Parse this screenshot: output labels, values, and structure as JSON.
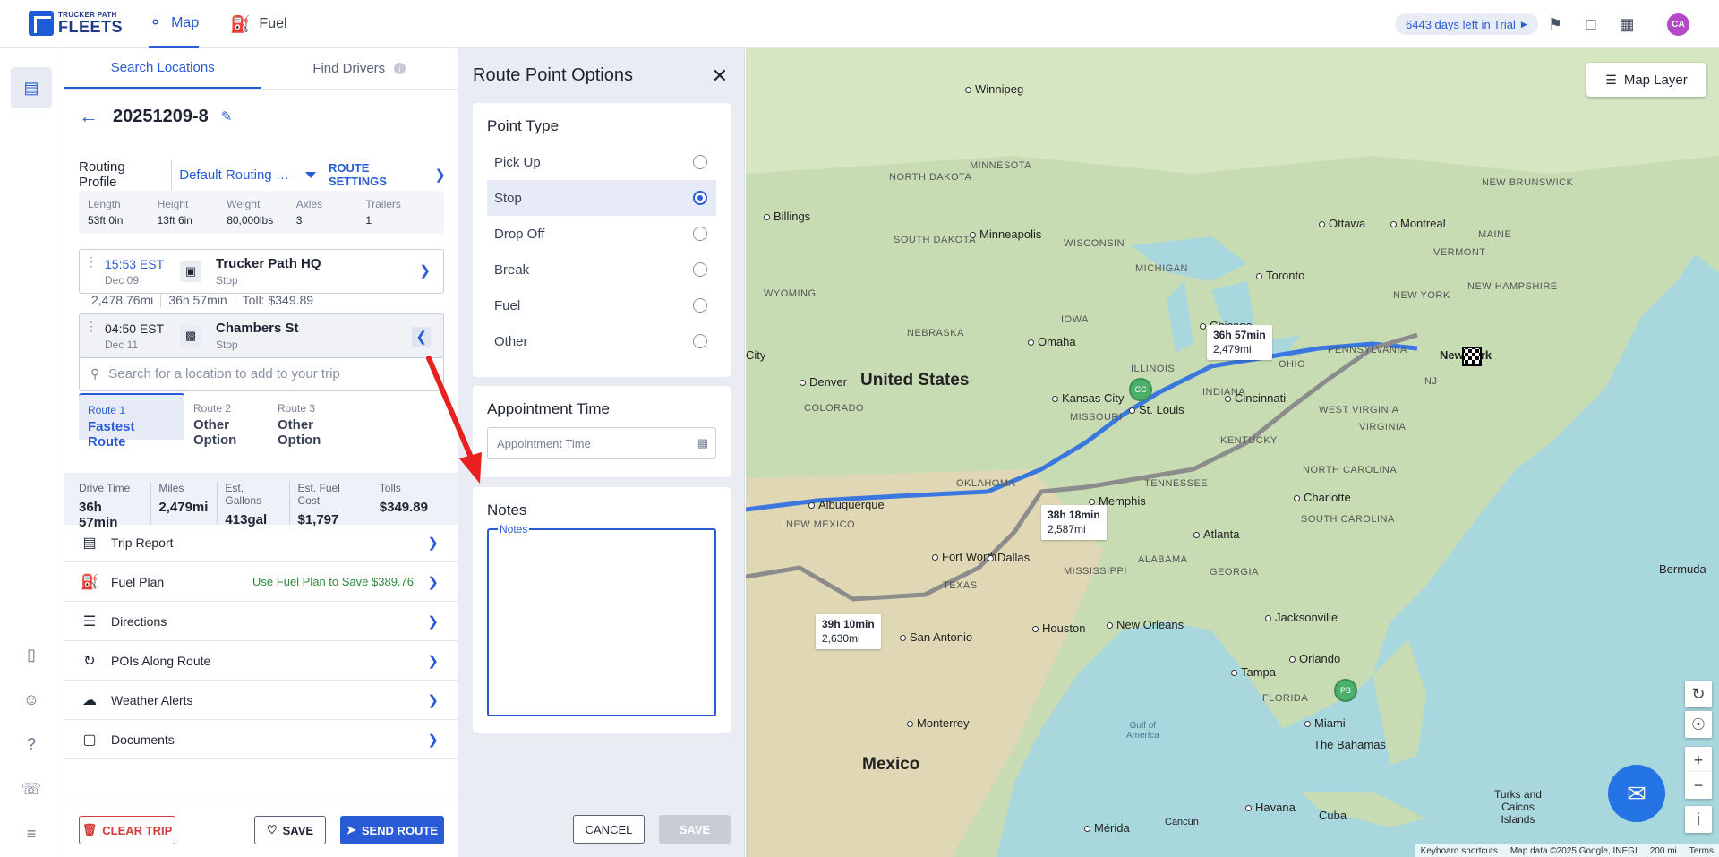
{
  "brand": {
    "small": "TRUCKER PATH",
    "big": "FLEETS"
  },
  "nav": {
    "map": "Map",
    "fuel": "Fuel"
  },
  "trial": "6443 days left in Trial",
  "user_initials": "CA",
  "search_tabs": {
    "search": "Search Locations",
    "drivers": "Find Drivers",
    "info": "i"
  },
  "trip": {
    "name": "20251209-8"
  },
  "routing": {
    "label": "Routing Profile",
    "value": "Default Routing Pr...",
    "settings": "ROUTE SETTINGS"
  },
  "specs": [
    {
      "label": "Length",
      "value": "53ft 0in"
    },
    {
      "label": "Height",
      "value": "13ft 6in"
    },
    {
      "label": "Weight",
      "value": "80,000lbs"
    },
    {
      "label": "Axles",
      "value": "3"
    },
    {
      "label": "Trailers",
      "value": "1"
    }
  ],
  "stops": [
    {
      "time": "15:53 EST",
      "date": "Dec 09",
      "name": "Trucker Path HQ",
      "kind": "Stop"
    },
    {
      "time": "04:50 EST",
      "date": "Dec 11",
      "name": "Chambers St",
      "kind": "Stop"
    }
  ],
  "between": {
    "miles": "2,478.76mi",
    "time": "36h 57min",
    "toll": "Toll: $349.89"
  },
  "search_placeholder": "Search for a location to add to your trip",
  "routes": [
    {
      "num": "Route 1",
      "name": "Fastest Route"
    },
    {
      "num": "Route 2",
      "name": "Other Option"
    },
    {
      "num": "Route 3",
      "name": "Other Option"
    }
  ],
  "metrics": [
    {
      "label": "Drive Time",
      "value": "36h 57min"
    },
    {
      "label": "Miles",
      "value": "2,479mi"
    },
    {
      "label": "Est. Gallons",
      "value": "413gal"
    },
    {
      "label": "Est. Fuel Cost",
      "value": "$1,797"
    },
    {
      "label": "Tolls",
      "value": "$349.89"
    }
  ],
  "menu": [
    {
      "label": "Trip Report",
      "icon": "document-icon"
    },
    {
      "label": "Fuel Plan",
      "icon": "fuel-pump-icon",
      "promo": "Use Fuel Plan to Save $389.76"
    },
    {
      "label": "Directions",
      "icon": "list-icon"
    },
    {
      "label": "POIs Along Route",
      "icon": "route-icon"
    },
    {
      "label": "Weather Alerts",
      "icon": "cloud-icon"
    },
    {
      "label": "Documents",
      "icon": "folder-icon"
    }
  ],
  "footer": {
    "clear": "CLEAR TRIP",
    "save": "SAVE",
    "send": "SEND ROUTE"
  },
  "rpo": {
    "title": "Route Point Options",
    "point_type": "Point Type",
    "options": [
      "Pick Up",
      "Stop",
      "Drop Off",
      "Break",
      "Fuel",
      "Other"
    ],
    "selected": "Stop",
    "appt_title": "Appointment Time",
    "appt_placeholder": "Appointment Time",
    "notes_title": "Notes",
    "notes_legend": "Notes",
    "cancel": "CANCEL",
    "save": "SAVE"
  },
  "map": {
    "layer_btn": "Map Layer",
    "route_labels": [
      {
        "time": "36h 57min",
        "dist": "2,479mi"
      },
      {
        "time": "38h 18min",
        "dist": "2,587mi"
      },
      {
        "time": "39h 10min",
        "dist": "2,630mi"
      }
    ],
    "pins": [
      "CC",
      "PB"
    ],
    "labels": {
      "country_us": "United States",
      "country_mx": "Mexico",
      "winnipeg": "Winnipeg",
      "north_dakota": "NORTH DAKOTA",
      "south_dakota": "SOUTH DAKOTA",
      "minnesota": "MINNESOTA",
      "minneapolis": "Minneapolis",
      "wisconsin": "WISCONSIN",
      "michigan": "MICHIGAN",
      "iowa": "IOWA",
      "nebraska": "NEBRASKA",
      "omaha": "Omaha",
      "illinois": "ILLINOIS",
      "chicago": "Chicago",
      "ohio": "OHIO",
      "indiana": "INDIANA",
      "denver": "Denver",
      "colorado": "COLORADO",
      "kansas_city": "Kansas City",
      "missouri": "MISSOURI",
      "st_louis": "St. Louis",
      "cincinnati": "Cincinnati",
      "kentucky": "KENTUCKY",
      "west_virginia": "WEST VIRGINIA",
      "virginia": "VIRGINIA",
      "pennsylvania": "PENNSYLVANIA",
      "new_york_state": "NEW YORK",
      "new_york": "New York",
      "nj": "NJ",
      "toronto": "Toronto",
      "ottawa": "Ottawa",
      "montreal": "Montreal",
      "maine": "MAINE",
      "new_brunswick": "NEW BRUNSWICK",
      "new_hampshire": "NEW HAMPSHIRE",
      "vermont": "VERMONT",
      "wyoming": "WYOMING",
      "billings": "Billings",
      "oklahoma": "OKLAHOMA",
      "tennessee": "TENNESSEE",
      "memphis": "Memphis",
      "charlotte": "Charlotte",
      "north_carolina": "NORTH CAROLINA",
      "south_carolina": "SOUTH CAROLINA",
      "atlanta": "Atlanta",
      "georgia": "GEORGIA",
      "alabama": "ALABAMA",
      "mississippi": "MISSISSIPPI",
      "new_mexico": "NEW MEXICO",
      "albuquerque": "Albuquerque",
      "texas": "TEXAS",
      "fort_worth": "Fort Worth",
      "dallas": "Dallas",
      "san_antonio": "San Antonio",
      "houston": "Houston",
      "new_orleans": "New Orleans",
      "jacksonville": "Jacksonville",
      "orlando": "Orlando",
      "tampa": "Tampa",
      "florida": "FLORIDA",
      "miami": "Miami",
      "the_bahamas": "The Bahamas",
      "bermuda": "Bermuda",
      "gulf": "Gulf of\nAmerica",
      "monterrey": "Monterrey",
      "merida": "Mérida",
      "cancun": "Cancún",
      "havana": "Havana",
      "cuba": "Cuba",
      "turks": "Turks and\nCaicos\nIslands",
      "city": "City"
    },
    "footer": {
      "shortcuts": "Keyboard shortcuts",
      "data": "Map data ©2025 Google, INEGI",
      "scale": "200 mi",
      "terms": "Terms"
    }
  },
  "colors": {
    "accent": "#2a5bd7",
    "route_primary": "#3a78e0",
    "route_alt": "#8c8c8c",
    "pin": "#4caf6a",
    "annotation_arrow": "#e82020"
  }
}
